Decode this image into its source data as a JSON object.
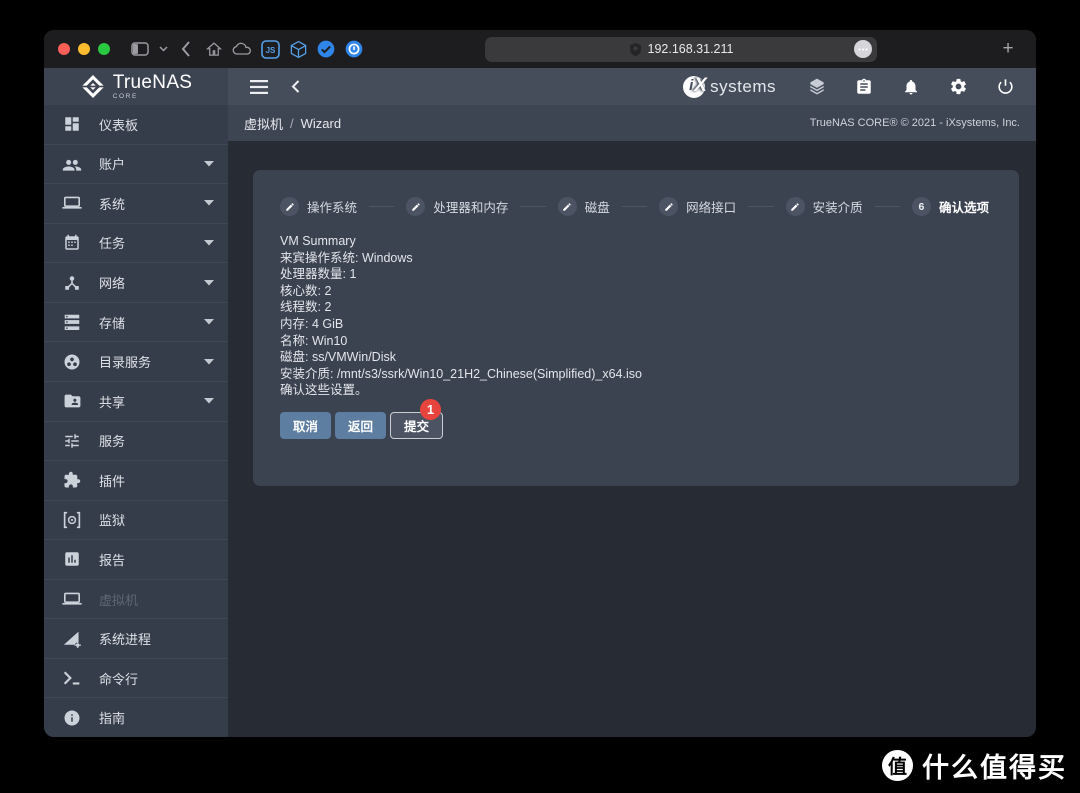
{
  "browser": {
    "url": "192.168.31.211",
    "new_tab_label": "+",
    "js_badge_label": "JS"
  },
  "app_header": {
    "brand": "TrueNAS",
    "brand_edition": "CORE",
    "ix_mark_i": "i",
    "ix_mark_x": "X",
    "ix_text": "systems"
  },
  "breadcrumb": {
    "section": "虚拟机",
    "separator": "/",
    "page": "Wizard",
    "copyright": "TrueNAS CORE® © 2021 - iXsystems, Inc."
  },
  "sidebar": {
    "items": [
      {
        "label": "仪表板",
        "icon": "dashboard",
        "expandable": false
      },
      {
        "label": "账户",
        "icon": "group",
        "expandable": true
      },
      {
        "label": "系统",
        "icon": "laptop",
        "expandable": true
      },
      {
        "label": "任务",
        "icon": "calendar",
        "expandable": true
      },
      {
        "label": "网络",
        "icon": "device-hub",
        "expandable": true
      },
      {
        "label": "存储",
        "icon": "storage",
        "expandable": true
      },
      {
        "label": "目录服务",
        "icon": "group-work",
        "expandable": true
      },
      {
        "label": "共享",
        "icon": "folder-shared",
        "expandable": true
      },
      {
        "label": "服务",
        "icon": "tune",
        "expandable": false
      },
      {
        "label": "插件",
        "icon": "extension",
        "expandable": false
      },
      {
        "label": "监狱",
        "icon": "jail",
        "expandable": false
      },
      {
        "label": "报告",
        "icon": "bar-chart",
        "expandable": false
      },
      {
        "label": "虚拟机",
        "icon": "laptop",
        "expandable": false,
        "active": true
      },
      {
        "label": "系统进程",
        "icon": "processes",
        "expandable": false
      },
      {
        "label": "命令行",
        "icon": "shell",
        "expandable": false
      },
      {
        "label": "指南",
        "icon": "info",
        "expandable": false
      }
    ]
  },
  "wizard": {
    "steps": [
      {
        "label": "操作系统",
        "state": "edit"
      },
      {
        "label": "处理器和内存",
        "state": "edit"
      },
      {
        "label": "磁盘",
        "state": "edit"
      },
      {
        "label": "网络接口",
        "state": "edit"
      },
      {
        "label": "安装介质",
        "state": "edit"
      },
      {
        "label": "确认选项",
        "state": "active",
        "number": "6"
      }
    ],
    "summary_title": "VM Summary",
    "summary_lines": [
      "来宾操作系统: Windows",
      "处理器数量: 1",
      "核心数: 2",
      "线程数: 2",
      "内存: 4 GiB",
      "名称: Win10",
      "磁盘: ss/VMWin/Disk",
      "安装介质: /mnt/s3/ssrk/Win10_21H2_Chinese(Simplified)_x64.iso",
      "确认这些设置。"
    ],
    "buttons": {
      "cancel": "取消",
      "back": "返回",
      "submit": "提交"
    },
    "annotation_badge": "1"
  },
  "watermark": {
    "logo_char": "值",
    "brand": "什么值得买"
  },
  "colors": {
    "browser_chrome": "#1d1d1f",
    "header": "#454d5b",
    "logo_section": "#3d4451",
    "breadcrumb_bar": "#3e4552",
    "sidebar": "#363d4a",
    "content_bg": "#262b34",
    "card_bg": "#3b4250",
    "button_blue": "#5d7da1",
    "submit_gray": "#4c5463",
    "badge_red": "#e8443e",
    "accent_icon_blue": "#55a1e8",
    "traffic_red": "#ff5f57",
    "traffic_yellow": "#febc2e",
    "traffic_green": "#28c840"
  }
}
